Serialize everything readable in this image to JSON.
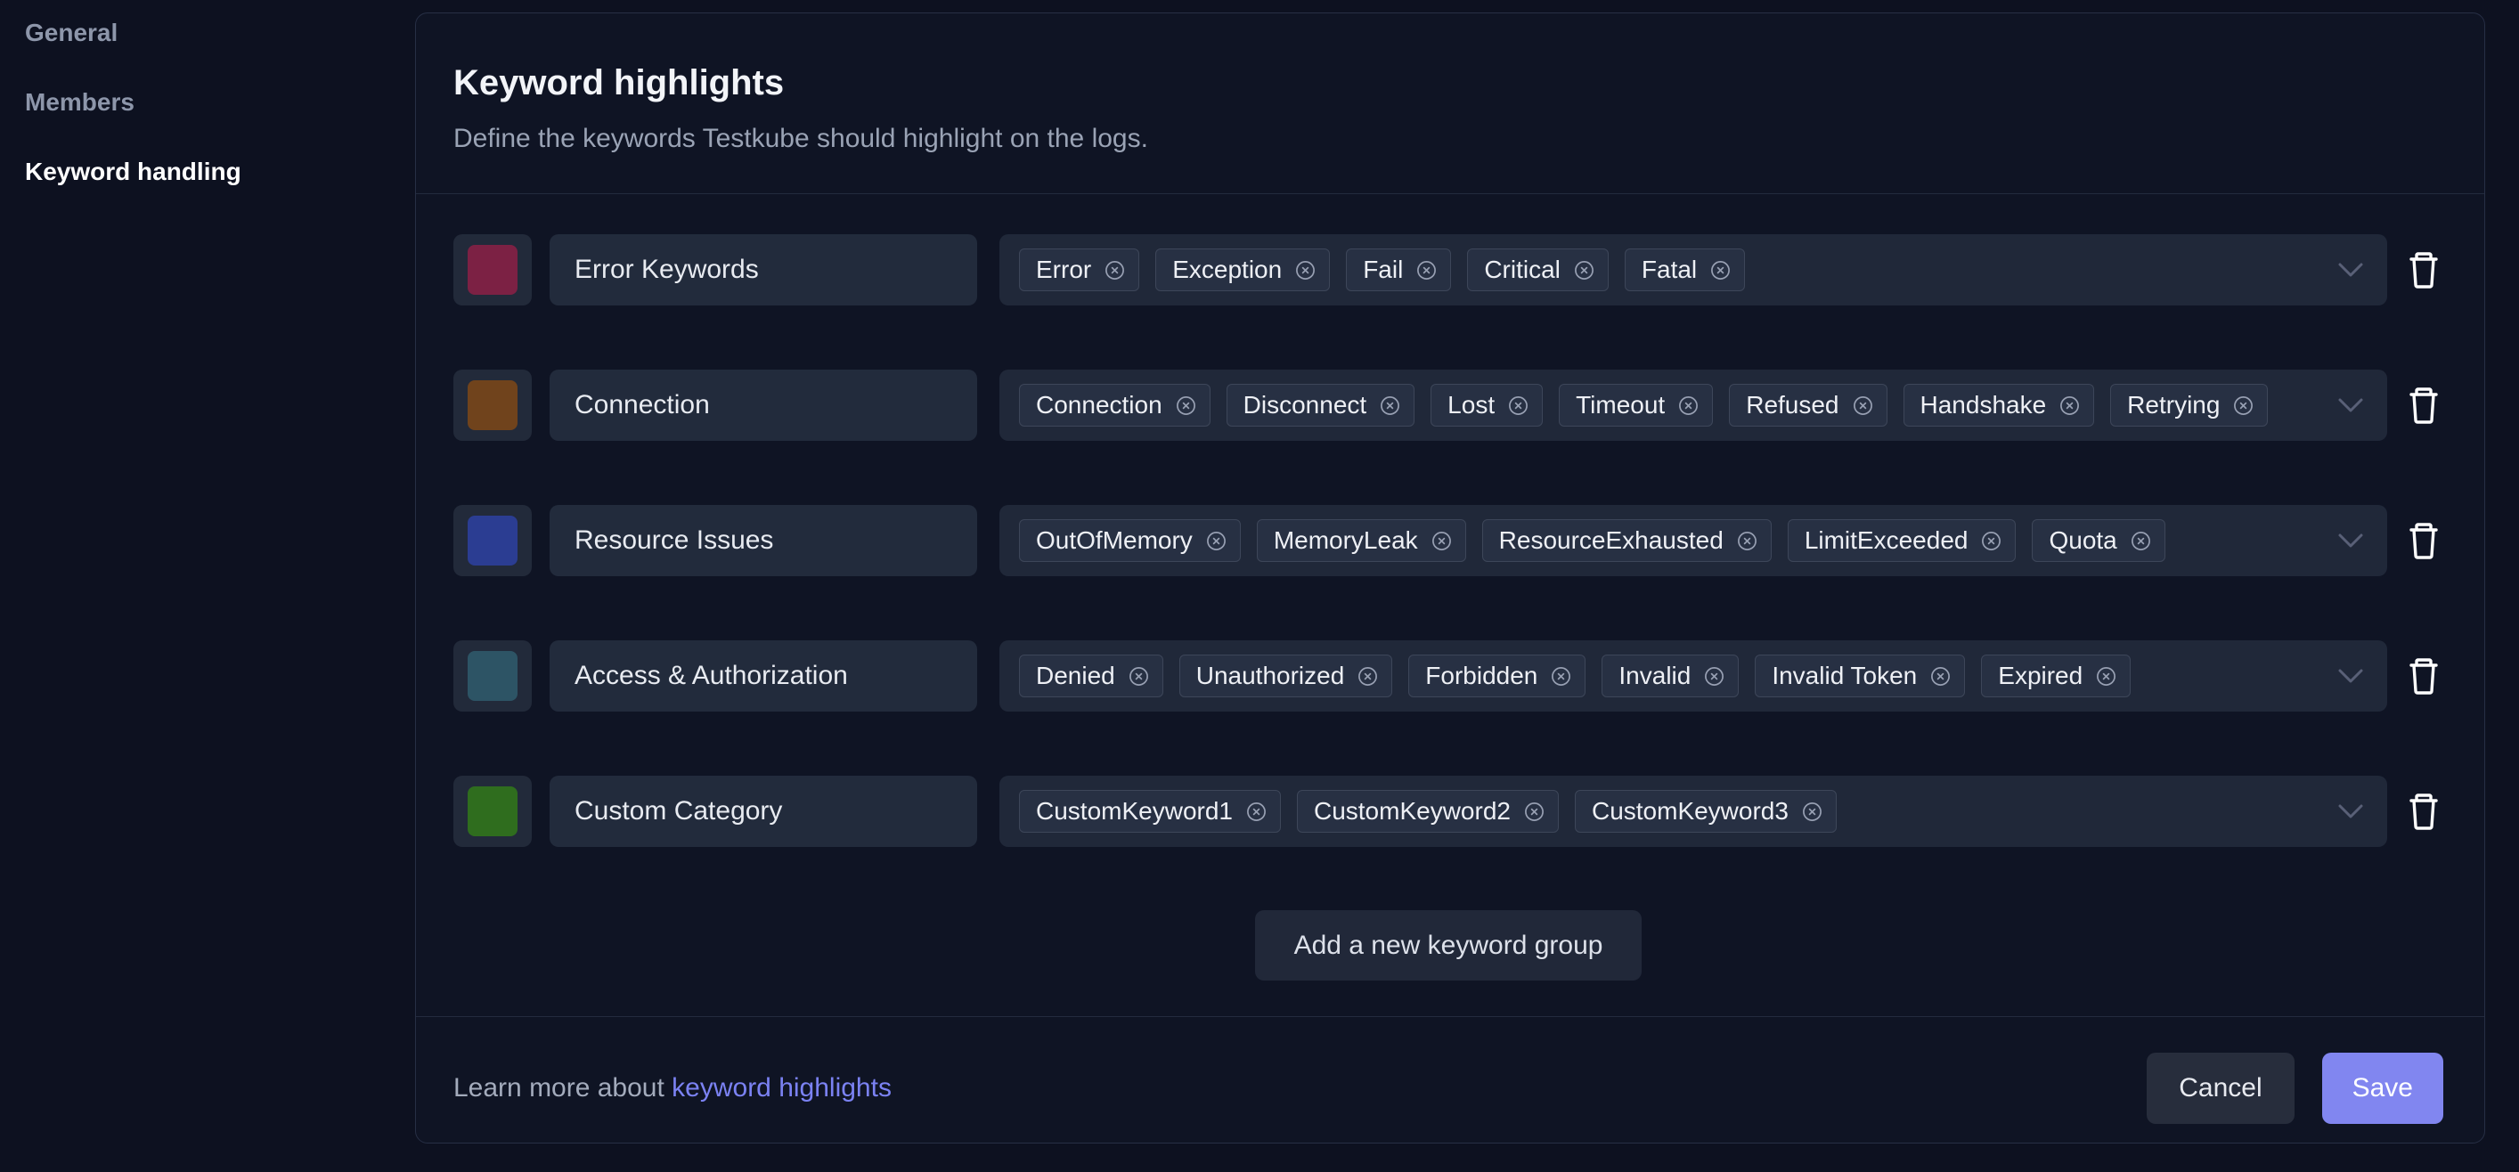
{
  "sidebar": {
    "items": [
      {
        "label": "General",
        "active": false
      },
      {
        "label": "Members",
        "active": false
      },
      {
        "label": "Keyword handling",
        "active": true
      }
    ]
  },
  "header": {
    "title": "Keyword highlights",
    "subtitle": "Define the keywords Testkube should highlight on the logs."
  },
  "groups": [
    {
      "name": "Error Keywords",
      "color": "#7c2144",
      "keywords": [
        "Error",
        "Exception",
        "Fail",
        "Critical",
        "Fatal"
      ]
    },
    {
      "name": "Connection",
      "color": "#70431c",
      "keywords": [
        "Connection",
        "Disconnect",
        "Lost",
        "Timeout",
        "Refused",
        "Handshake",
        "Retrying"
      ]
    },
    {
      "name": "Resource Issues",
      "color": "#2b3d92",
      "keywords": [
        "OutOfMemory",
        "MemoryLeak",
        "ResourceExhausted",
        "LimitExceeded",
        "Quota"
      ]
    },
    {
      "name": "Access & Authorization",
      "color": "#2d5465",
      "keywords": [
        "Denied",
        "Unauthorized",
        "Forbidden",
        "Invalid",
        "Invalid Token",
        "Expired"
      ]
    },
    {
      "name": "Custom Category",
      "color": "#2f6d1e",
      "keywords": [
        "CustomKeyword1",
        "CustomKeyword2",
        "CustomKeyword3"
      ]
    }
  ],
  "actions": {
    "add_group": "Add a new keyword group",
    "cancel": "Cancel",
    "save": "Save"
  },
  "footer": {
    "learn_more_prefix": "Learn more about ",
    "learn_more_link": "keyword highlights"
  },
  "colors": {
    "accent_save": "#8186f0",
    "link": "#7b82f3",
    "panel_border": "#272f45",
    "box_background": "#212a3b"
  }
}
